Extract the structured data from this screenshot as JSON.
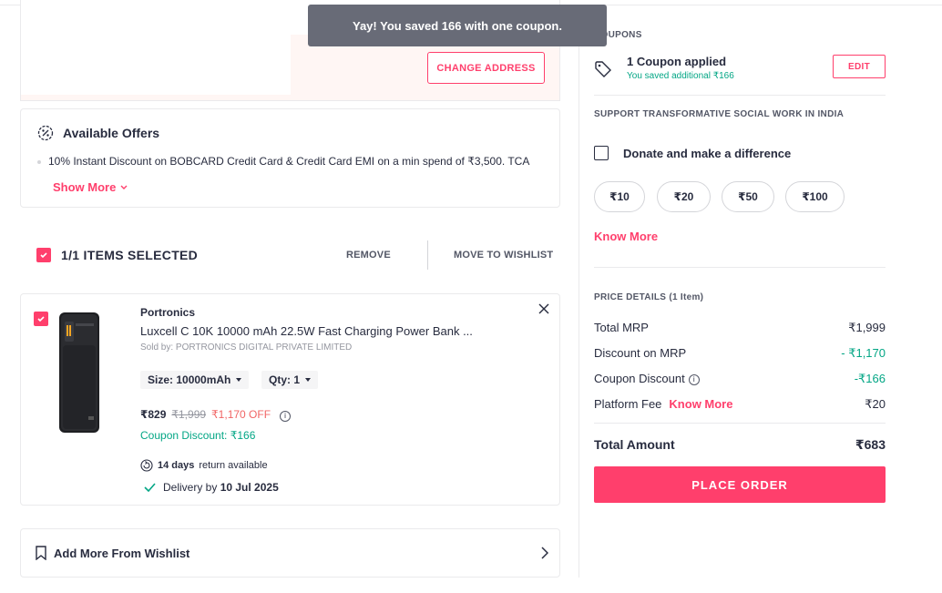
{
  "toast": {
    "message": "Yay! You saved 166 with one coupon."
  },
  "address": {
    "change_label": "CHANGE ADDRESS"
  },
  "offers": {
    "title": "Available Offers",
    "items": [
      "10% Instant Discount on BOBCARD Credit Card & Credit Card EMI on a min spend of ₹3,500. TCA"
    ],
    "show_more": "Show More"
  },
  "selection": {
    "label": "1/1 ITEMS SELECTED",
    "remove": "REMOVE",
    "move_to_wishlist": "MOVE TO WISHLIST"
  },
  "item": {
    "brand": "Portronics",
    "title": "Luxcell C 10K 10000 mAh 22.5W Fast Charging Power Bank ...",
    "seller": "Sold by: PORTRONICS DIGITAL PRIVATE LIMITED",
    "size": "Size: 10000mAh",
    "qty": "Qty: 1",
    "price": "₹829",
    "mrp": "₹1,999",
    "off": "₹1,170 OFF",
    "coupon_discount": "Coupon Discount: ₹166",
    "return_days": "14 days",
    "return_text": "return available",
    "delivery_prefix": "Delivery by",
    "delivery_date": "10 Jul 2025"
  },
  "wishlist": {
    "label": "Add More From Wishlist"
  },
  "coupons": {
    "section_title": "COUPONS",
    "applied": "1 Coupon applied",
    "saved": "You saved additional ₹166",
    "edit": "EDIT"
  },
  "social": {
    "section_title": "SUPPORT TRANSFORMATIVE SOCIAL WORK IN INDIA",
    "donate_label": "Donate and make a difference",
    "amounts": [
      "₹10",
      "₹20",
      "₹50",
      "₹100"
    ],
    "know_more": "Know More"
  },
  "price_details": {
    "section_title": "PRICE DETAILS (1 Item)",
    "total_mrp_label": "Total MRP",
    "total_mrp": "₹1,999",
    "discount_label": "Discount on MRP",
    "discount": "- ₹1,170",
    "coupon_label": "Coupon Discount",
    "coupon": "-₹166",
    "platform_label": "Platform Fee",
    "platform_know_more": "Know More",
    "platform": "₹20",
    "total_label": "Total Amount",
    "total": "₹683"
  },
  "place_order": "PLACE ORDER",
  "colors": {
    "accent": "#ff3f6c",
    "success": "#03a685",
    "strike": "#f16565"
  }
}
